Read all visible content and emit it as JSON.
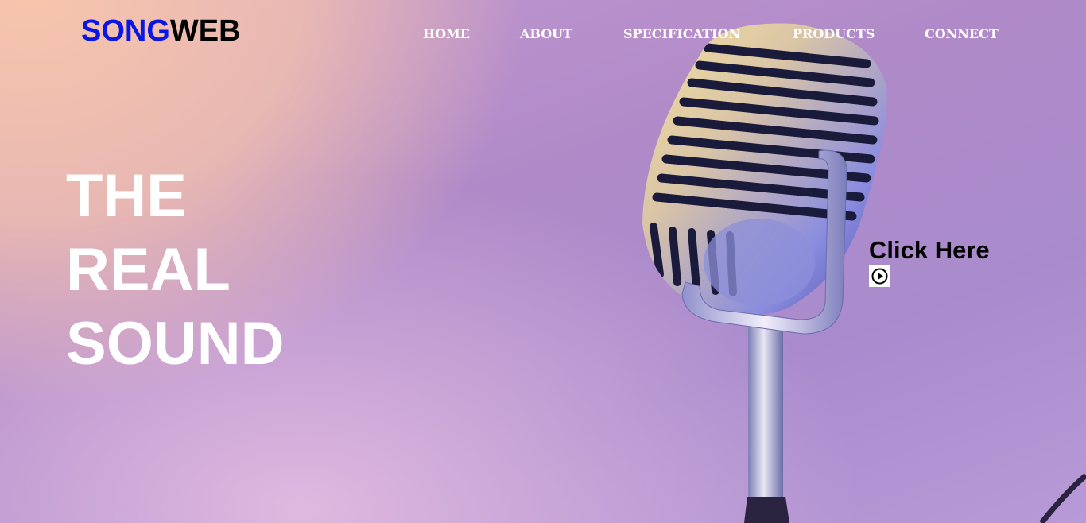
{
  "brand": {
    "part1": "SONG",
    "part2": "WEB",
    "color1": "#0a16e6",
    "color2": "#000000"
  },
  "nav": {
    "items": [
      {
        "label": "HOME"
      },
      {
        "label": "ABOUT"
      },
      {
        "label": "SPECIFICATION"
      },
      {
        "label": "PRODUCTS"
      },
      {
        "label": "CONNECT"
      }
    ]
  },
  "hero": {
    "headline_lines": [
      "THE",
      "REAL",
      "SOUND"
    ],
    "image": "microphone"
  },
  "cta": {
    "label": "Click Here",
    "icon": "play-circle-icon"
  }
}
